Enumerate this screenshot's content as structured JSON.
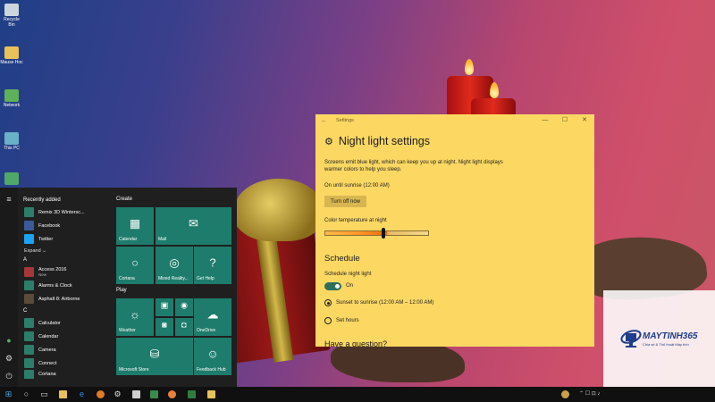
{
  "desktop": {
    "icons": [
      {
        "label": "Recycle Bin",
        "icon": "recycle-bin-icon",
        "color": "#cfd5dc"
      },
      {
        "label": "Mause Hoc",
        "icon": "folder-icon",
        "color": "#e8c15a"
      },
      {
        "label": "Network",
        "icon": "network-icon",
        "color": "#5fb05a"
      },
      {
        "label": "This PC",
        "icon": "computer-icon",
        "color": "#6ab0c8"
      },
      {
        "label": "",
        "icon": "app-icon",
        "color": "#4fa86a"
      }
    ]
  },
  "start_menu": {
    "recently_added_label": "Recently added",
    "recent": [
      {
        "name": "Remix 3D Wintersc...",
        "icon": "remix3d-icon"
      },
      {
        "name": "Facebook",
        "icon": "facebook-icon"
      },
      {
        "name": "Twitter",
        "icon": "twitter-icon"
      }
    ],
    "expand_label": "Expand ⌄",
    "sections": [
      {
        "letter": "A",
        "apps": [
          {
            "name": "Access 2016",
            "sub": "New",
            "icon": "access-icon"
          },
          {
            "name": "Alarms & Clock",
            "sub": "",
            "icon": "alarm-icon"
          },
          {
            "name": "Asphalt 8: Airborne",
            "sub": "",
            "icon": "asphalt-icon"
          }
        ]
      },
      {
        "letter": "C",
        "apps": [
          {
            "name": "Calculator",
            "sub": "",
            "icon": "calculator-icon"
          },
          {
            "name": "Calendar",
            "sub": "",
            "icon": "calendar-icon"
          },
          {
            "name": "Camera",
            "sub": "",
            "icon": "camera-icon"
          },
          {
            "name": "Connect",
            "sub": "",
            "icon": "connect-icon"
          },
          {
            "name": "Cortana",
            "sub": "",
            "icon": "cortana-icon"
          }
        ]
      }
    ],
    "create_label": "Create",
    "play_label": "Play",
    "tiles": {
      "calendar": "Calendar",
      "mail": "Mail",
      "cortana": "Cortana",
      "mixed_reality": "Mixed Reality...",
      "get_help": "Get Help",
      "weather": "Weather",
      "onedrive": "OneDrive",
      "store": "Microsoft Store",
      "feedback": "Feedback Hub"
    },
    "tile_color": "#1e7c6c"
  },
  "settings": {
    "window_title": "Settings",
    "page_title": "Night light settings",
    "description": "Screens emit blue light, which can keep you up at night. Night light displays warmer colors to help you sleep.",
    "status": "On until sunrise (12:00 AM)",
    "turn_off_label": "Turn off now",
    "color_temp_label": "Color temperature at night",
    "color_temp_level": 0.56,
    "schedule_heading": "Schedule",
    "schedule_label": "Schedule night light",
    "schedule_state": "On",
    "options": [
      {
        "label": "Sunset to sunrise (12:00 AM – 12:00 AM)",
        "selected": true
      },
      {
        "label": "Set hours",
        "selected": false
      }
    ],
    "question": "Have a question?",
    "background_color": "#fcd863"
  },
  "watermark": {
    "brand": "MAYTINH365",
    "tagline": "Chia sẻ & Thủ thuật Máy tính"
  },
  "taskbar": {
    "tray_text": "⌃ ☐ ⊡ ♪"
  }
}
